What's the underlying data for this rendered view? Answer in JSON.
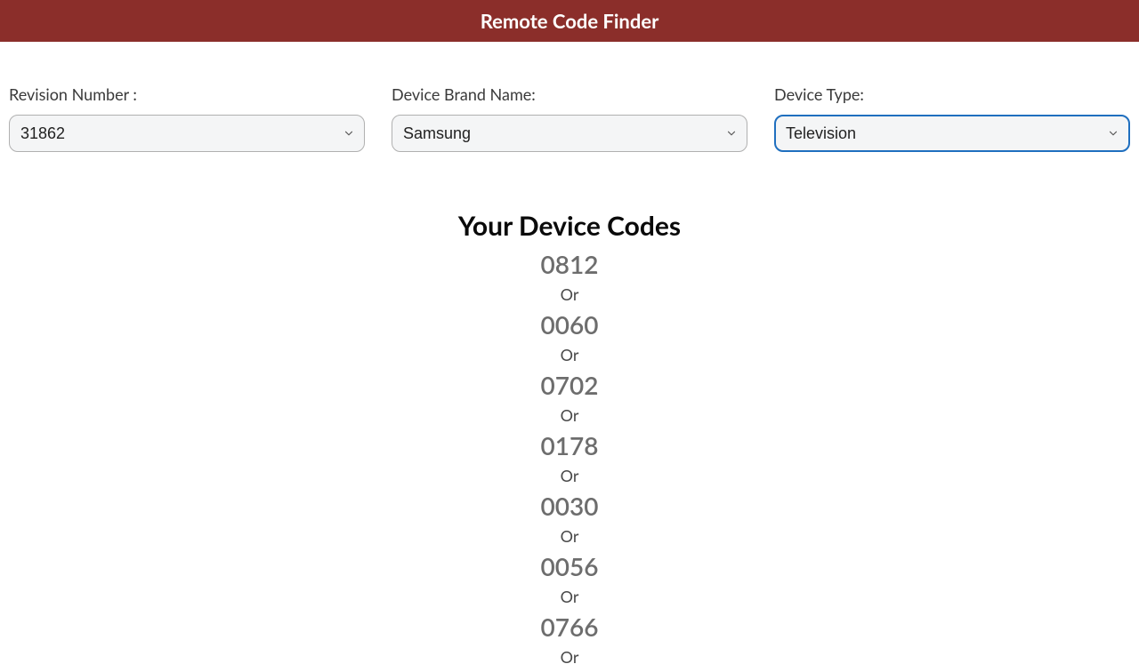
{
  "header": {
    "title": "Remote Code Finder"
  },
  "filters": {
    "revision": {
      "label": "Revision Number :",
      "value": "31862"
    },
    "brand": {
      "label": "Device Brand Name:",
      "value": "Samsung"
    },
    "type": {
      "label": "Device Type:",
      "value": "Television"
    }
  },
  "results": {
    "title": "Your Device Codes",
    "separator": "Or",
    "codes": [
      "0812",
      "0060",
      "0702",
      "0178",
      "0030",
      "0056",
      "0766"
    ]
  }
}
